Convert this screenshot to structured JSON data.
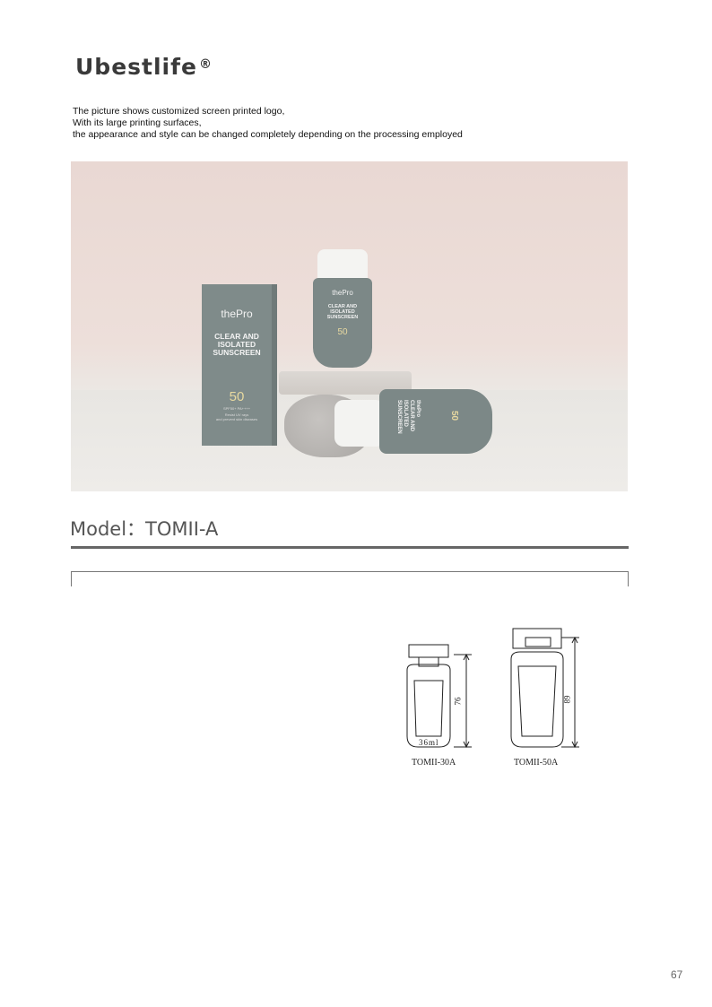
{
  "brand": {
    "name": "Ubestlife",
    "mark": "®"
  },
  "intro": {
    "lines": [
      "The picture shows customized screen printed logo,",
      "With its large printing surfaces,",
      "the appearance and style can be changed completely depending on the processing employed"
    ]
  },
  "product_photo": {
    "box": {
      "brand": "thePro",
      "title_lines": [
        "CLEAR AND",
        "ISOLATED",
        "SUNSCREEN"
      ],
      "spf": "50",
      "spf_sub": "SPF50+ PA++++",
      "small_lines": [
        "Resist UV rays",
        "and prevent skin diseases"
      ]
    },
    "bottle_upright": {
      "brand": "thePro",
      "title_lines": [
        "CLEAR AND",
        "ISOLATED",
        "SUNSCREEN"
      ],
      "spf": "50"
    },
    "bottle_lying": {
      "title_lines": [
        "thePro",
        "CLEAR AND",
        "ISOLATED",
        "SUNSCREEN"
      ],
      "spf": "50"
    }
  },
  "model": {
    "text": "Model：TOMII-A"
  },
  "drawings": {
    "small": {
      "label": "TOMII-30A",
      "volume": "36ml",
      "height": "76"
    },
    "large": {
      "label": "TOMII-50A",
      "height": "89"
    }
  },
  "page_number": "67"
}
